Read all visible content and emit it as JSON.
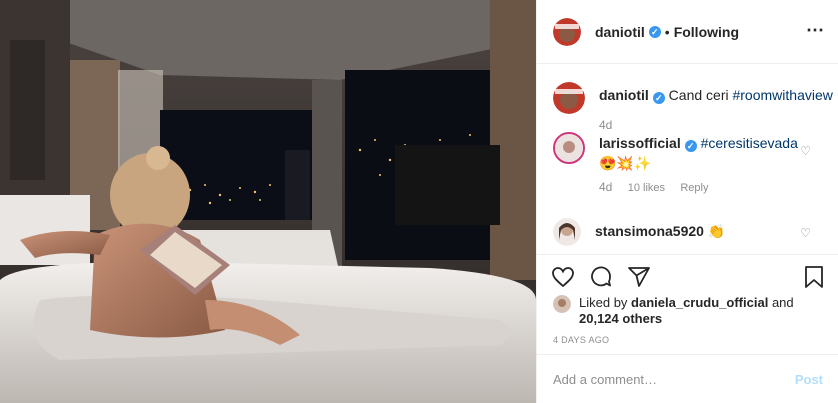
{
  "post": {
    "author": "daniotil",
    "follow_status": "Following",
    "caption_user": "daniotil",
    "caption_text": "Cand ceri",
    "caption_hashtag": "#roomwithaview",
    "caption_age": "4d"
  },
  "comments": [
    {
      "user": "larissofficial",
      "hashtag": "#ceresitisevada",
      "emoji": "😍💥✨",
      "age": "4d",
      "likes": "10 likes",
      "reply": "Reply"
    },
    {
      "user": "stansimona5920",
      "emoji": "👏"
    }
  ],
  "likes": {
    "prefix": "Liked by",
    "user": "daniela_crudu_official",
    "connector": "and",
    "count": "20,124 others"
  },
  "timestamp": "4 DAYS AGO",
  "add_comment": {
    "placeholder": "Add a comment…",
    "post_label": "Post"
  },
  "icons": [
    "heart-icon",
    "comment-icon",
    "share-icon",
    "bookmark-icon",
    "more-icon",
    "verified-icon"
  ]
}
